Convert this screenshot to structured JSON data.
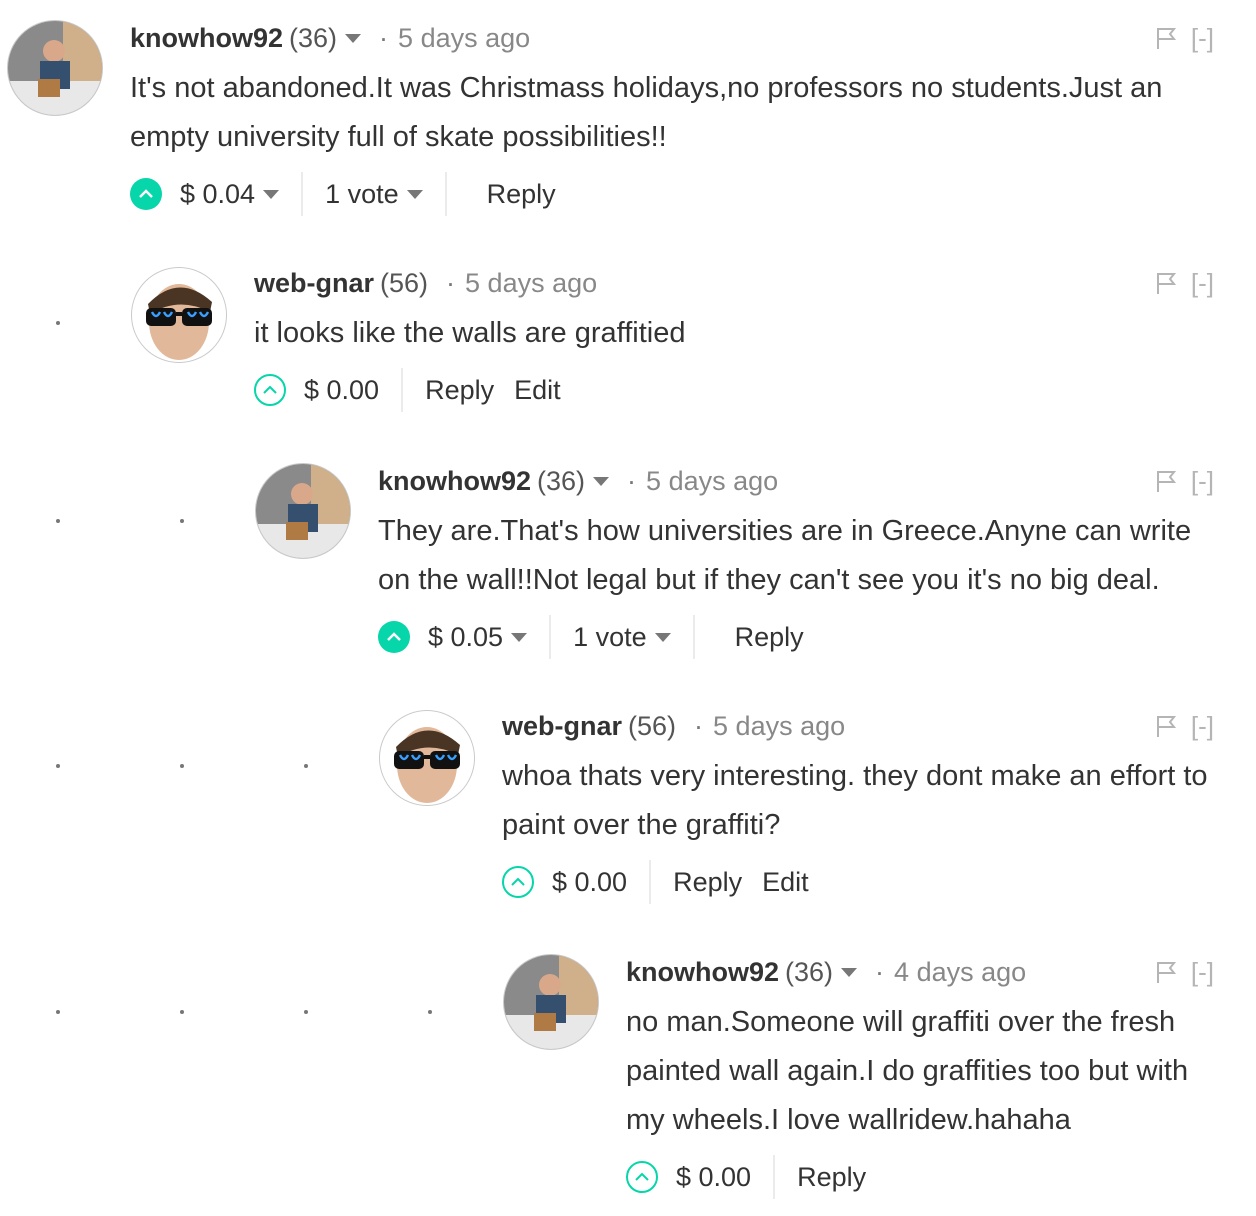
{
  "comments": [
    {
      "author": "knowhow92",
      "reputation": "(36)",
      "time": "5 days ago",
      "flag_placeholder": "[-]",
      "text": "It's not abandoned.It was Christmass holidays,no professors no students.Just an empty university full of skate possibilities!!",
      "payout": "$ 0.04",
      "votes": "1 vote",
      "reply_label": "Reply",
      "edit_label": "",
      "upvoted": true
    },
    {
      "author": "web-gnar",
      "reputation": "(56)",
      "time": "5 days ago",
      "flag_placeholder": "[-]",
      "text": "it looks like the walls are graffitied",
      "payout": "$ 0.00",
      "votes": "",
      "reply_label": "Reply",
      "edit_label": "Edit",
      "upvoted": false
    },
    {
      "author": "knowhow92",
      "reputation": "(36)",
      "time": "5 days ago",
      "flag_placeholder": "[-]",
      "text": "They are.That's how universities are in Greece.Anyne can write on the wall!!Not legal but if they can't see you it's no big deal.",
      "payout": "$ 0.05",
      "votes": "1 vote",
      "reply_label": "Reply",
      "edit_label": "",
      "upvoted": true
    },
    {
      "author": "web-gnar",
      "reputation": "(56)",
      "time": "5 days ago",
      "flag_placeholder": "[-]",
      "text": "whoa thats very interesting. they dont make an effort to paint over the graffiti?",
      "payout": "$ 0.00",
      "votes": "",
      "reply_label": "Reply",
      "edit_label": "Edit",
      "upvoted": false
    },
    {
      "author": "knowhow92",
      "reputation": "(36)",
      "time": "4 days ago",
      "flag_placeholder": "[-]",
      "text": "no man.Someone will graffiti over the fresh painted wall again.I do graffities too but with my wheels.I love wallridew.hahaha",
      "payout": "$ 0.00",
      "votes": "",
      "reply_label": "Reply",
      "edit_label": "",
      "upvoted": false
    }
  ],
  "colors": {
    "upvote_accent": "#06d6a9",
    "author": "#333333",
    "muted": "#888888"
  }
}
